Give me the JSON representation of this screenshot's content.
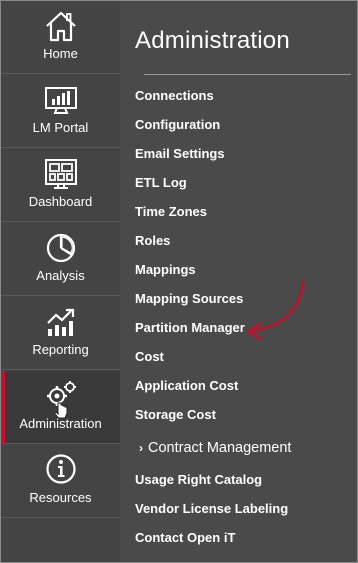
{
  "sidebar": {
    "items": [
      {
        "label": "Home",
        "icon": "home-icon"
      },
      {
        "label": "LM Portal",
        "icon": "bar-chart-monitor-icon"
      },
      {
        "label": "Dashboard",
        "icon": "dashboard-icon"
      },
      {
        "label": "Analysis",
        "icon": "pie-chart-icon"
      },
      {
        "label": "Reporting",
        "icon": "trend-chart-icon"
      },
      {
        "label": "Administration",
        "icon": "gears-icon",
        "active": true
      },
      {
        "label": "Resources",
        "icon": "info-icon"
      }
    ]
  },
  "panel": {
    "title": "Administration",
    "items": [
      {
        "label": "Connections"
      },
      {
        "label": "Configuration"
      },
      {
        "label": "Email Settings"
      },
      {
        "label": "ETL Log"
      },
      {
        "label": "Time Zones"
      },
      {
        "label": "Roles"
      },
      {
        "label": "Mappings"
      },
      {
        "label": "Mapping Sources"
      },
      {
        "label": "Partition Manager"
      },
      {
        "label": "Cost"
      },
      {
        "label": "Application Cost"
      },
      {
        "label": "Storage Cost"
      },
      {
        "label": "Contract Management",
        "collapsible": true
      },
      {
        "label": "Usage Right Catalog"
      },
      {
        "label": "Vendor License Labeling"
      },
      {
        "label": "Contact Open iT"
      }
    ]
  },
  "colors": {
    "sidebar_bg": "#444444",
    "panel_bg": "#4a4a4a",
    "active_accent": "#c8102e",
    "annotation_arrow": "#b0182e"
  }
}
